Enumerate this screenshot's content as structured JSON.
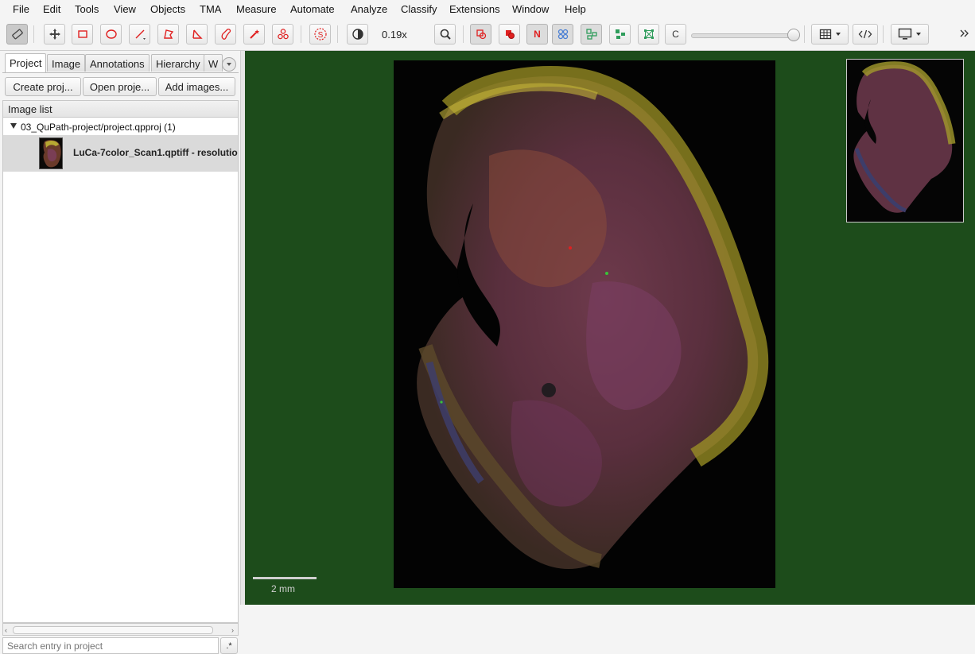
{
  "menu": [
    "File",
    "Edit",
    "Tools",
    "View",
    "Objects",
    "TMA",
    "Measure",
    "Automate",
    "Analyze",
    "Classify",
    "Extensions",
    "Window",
    "Help"
  ],
  "toolbar": {
    "zoom_label": "0.19x",
    "classify_button": "C",
    "n_button": "N",
    "brightness_slider_value": 0.95,
    "more_icon": "double-chevron-right-icon"
  },
  "left_panel": {
    "tabs": [
      "Project",
      "Image",
      "Annotations",
      "Hierarchy",
      "W"
    ],
    "active_tab": "Project",
    "buttons": {
      "create": "Create proj...",
      "open": "Open proje...",
      "add": "Add images..."
    },
    "image_list_header": "Image list",
    "project_node": "03_QuPath-project/project.qpproj (1)",
    "entry_label": "LuCa-7color_Scan1.qptiff - resolutio",
    "search_placeholder": "Search entry in project",
    "regex_button": ".*"
  },
  "viewer": {
    "scalebar_label": "2 mm",
    "background_color": "#1d4c1b"
  },
  "colors": {
    "accent_red": "#e02020",
    "tool_blue": "#4a7fd4",
    "tool_green": "#2f9d5c"
  }
}
